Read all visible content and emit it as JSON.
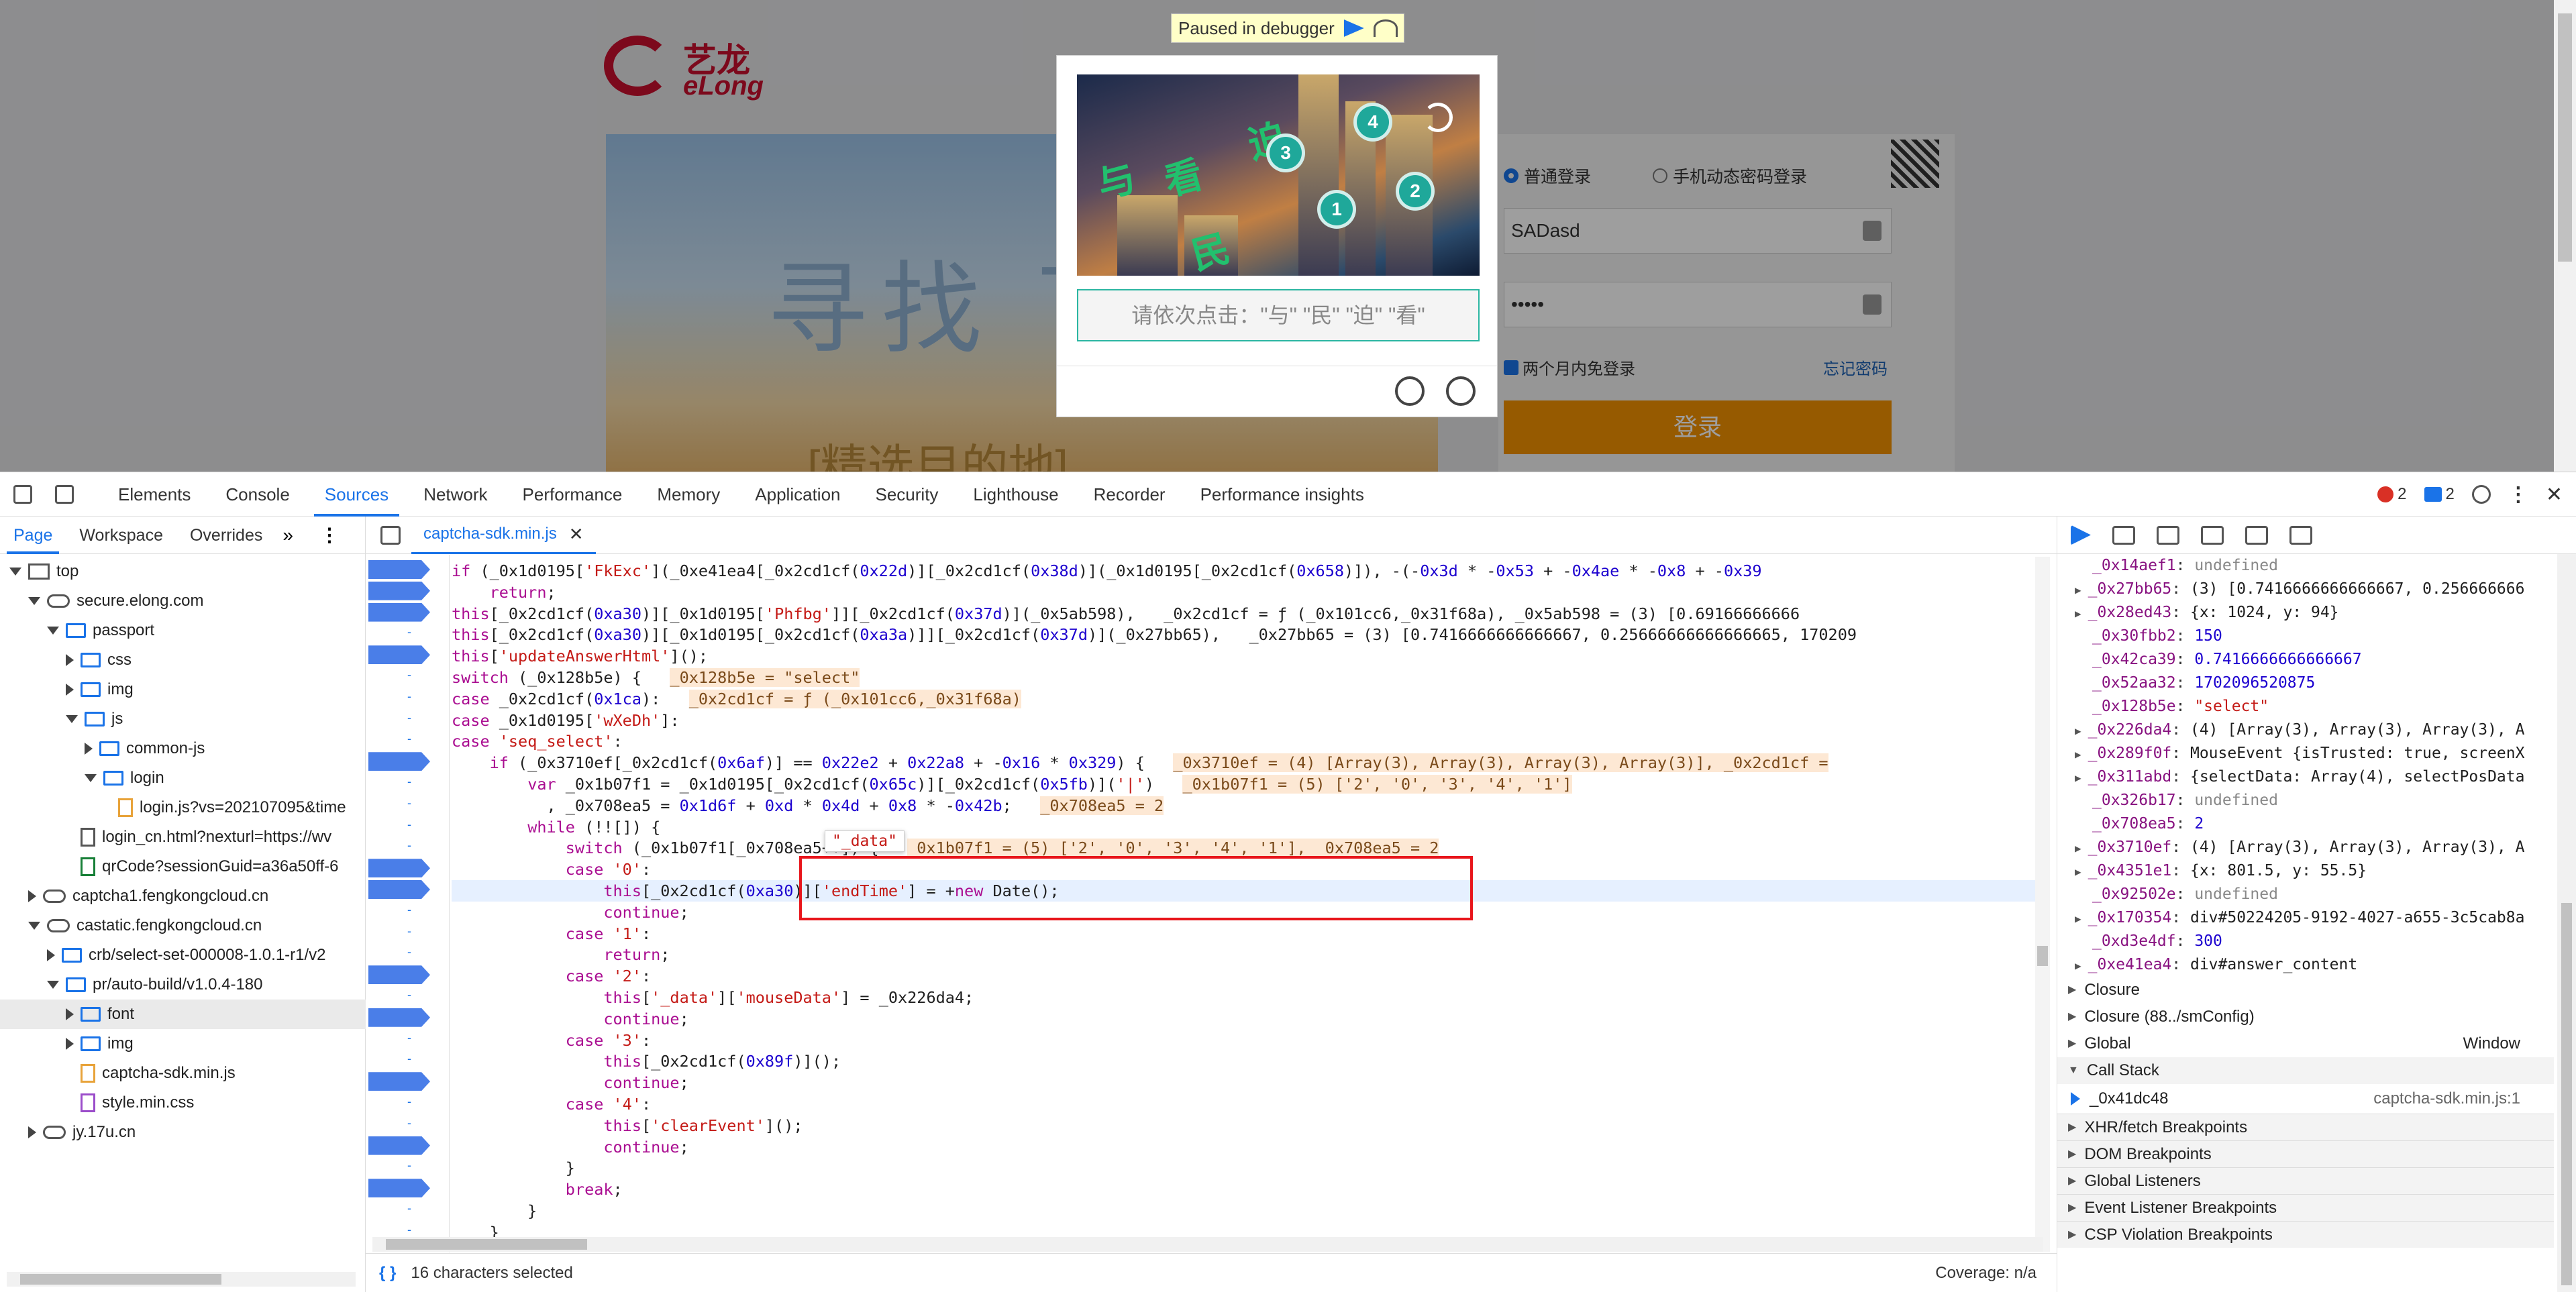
{
  "page": {
    "logo": {
      "cn": "艺龙",
      "en": "eLong"
    },
    "banner_text": "寻找 下",
    "banner_footer": "[精选目的地]",
    "paused_banner": "Paused in debugger",
    "captcha": {
      "chars": [
        "与",
        "看",
        "迫",
        "民"
      ],
      "numbers": [
        "1",
        "2",
        "3",
        "4"
      ],
      "hint": "请依次点击：\"与\" \"民\" \"迫\" \"看\""
    },
    "login": {
      "radio_normal": "普通登录",
      "radio_sms": "手机动态密码登录",
      "username_value": "SADasd",
      "password_value": "•••••",
      "remember_label": "两个月内免登录",
      "forgot_label": "忘记密码",
      "submit_label": "登录"
    }
  },
  "devtools": {
    "tabs": [
      "Elements",
      "Console",
      "Sources",
      "Network",
      "Performance",
      "Memory",
      "Application",
      "Security",
      "Lighthouse",
      "Recorder",
      "Performance insights"
    ],
    "active_tab": "Sources",
    "errors_count": "2",
    "messages_count": "2",
    "navigator_tabs": [
      "Page",
      "Workspace",
      "Overrides"
    ],
    "tree": [
      {
        "label": "top",
        "depth": 0,
        "icon": "window",
        "expand": "d"
      },
      {
        "label": "secure.elong.com",
        "depth": 1,
        "icon": "cloud",
        "expand": "d"
      },
      {
        "label": "passport",
        "depth": 2,
        "icon": "folder",
        "expand": "d"
      },
      {
        "label": "css",
        "depth": 3,
        "icon": "folder",
        "expand": "r"
      },
      {
        "label": "img",
        "depth": 3,
        "icon": "folder",
        "expand": "r"
      },
      {
        "label": "js",
        "depth": 3,
        "icon": "folder",
        "expand": "d"
      },
      {
        "label": "common-js",
        "depth": 4,
        "icon": "folder",
        "expand": "r"
      },
      {
        "label": "login",
        "depth": 4,
        "icon": "folder",
        "expand": "d"
      },
      {
        "label": "login.js?vs=202107095&time",
        "depth": 5,
        "icon": "file",
        "expand": "n"
      },
      {
        "label": "login_cn.html?nexturl=https://wv",
        "depth": 3,
        "icon": "file-html",
        "expand": "n"
      },
      {
        "label": "qrCode?sessionGuid=a36a50ff-6",
        "depth": 3,
        "icon": "file-green",
        "expand": "n"
      },
      {
        "label": "captcha1.fengkongcloud.cn",
        "depth": 1,
        "icon": "cloud",
        "expand": "r"
      },
      {
        "label": "castatic.fengkongcloud.cn",
        "depth": 1,
        "icon": "cloud",
        "expand": "d"
      },
      {
        "label": "crb/select-set-000008-1.0.1-r1/v2",
        "depth": 2,
        "icon": "folder",
        "expand": "r"
      },
      {
        "label": "pr/auto-build/v1.0.4-180",
        "depth": 2,
        "icon": "folder",
        "expand": "d"
      },
      {
        "label": "font",
        "depth": 3,
        "icon": "folder",
        "expand": "r",
        "selected": true
      },
      {
        "label": "img",
        "depth": 3,
        "icon": "folder",
        "expand": "r"
      },
      {
        "label": "captcha-sdk.min.js",
        "depth": 3,
        "icon": "file",
        "expand": "n"
      },
      {
        "label": "style.min.css",
        "depth": 3,
        "icon": "file-css",
        "expand": "n"
      },
      {
        "label": "jy.17u.cn",
        "depth": 1,
        "icon": "cloud",
        "expand": "r"
      }
    ],
    "open_file": "captcha-sdk.min.js",
    "code_lines": [
      "if (_0x1d0195['FkExc'](_0xe41ea4[_0x2cd1cf(0x22d)][_0x2cd1cf(0x38d)](_0x1d0195[_0x2cd1cf(0x658)]), -(-0x3d * -0x53 + -0x4ae * -0x8 + -0x39",
      "    return;",
      "this[_0x2cd1cf(0xa30)][_0x1d0195['Phfbg']][_0x2cd1cf(0x37d)](_0x5ab598),   _0x2cd1cf = ƒ (_0x101cc6,_0x31f68a), _0x5ab598 = (3) [0.69166666666",
      "this[_0x2cd1cf(0xa30)][_0x1d0195[_0x2cd1cf(0xa3a)]][_0x2cd1cf(0x37d)](_0x27bb65),   _0x27bb65 = (3) [0.7416666666666667, 0.25666666666666665, 170209",
      "this['updateAnswerHtml']();",
      "switch (_0x128b5e) {   _0x128b5e = \"select\"",
      "case _0x2cd1cf(0x1ca):   _0x2cd1cf = ƒ (_0x101cc6,_0x31f68a)",
      "case _0x1d0195['wXeDh']:",
      "case 'seq_select':",
      "    if (_0x3710ef[_0x2cd1cf(0x6af)] == 0x22e2 + 0x22a8 + -0x16 * 0x329) {   _0x3710ef = (4) [Array(3), Array(3), Array(3), Array(3)], _0x2cd1cf =",
      "        var _0x1b07f1 = _0x1d0195[_0x2cd1cf(0x65c)][_0x2cd1cf(0x5fb)]('|')   _0x1b07f1 = (5) ['2', '0', '3', '4', '1']",
      "          , _0x708ea5 = 0x1d6f + 0xd * 0x4d + 0x8 * -0x42b;   _0x708ea5 = 2",
      "        while (!![]) {",
      "            switch (_0x1b07f1[_0x708ea5++]) {   _0x1b07f1 = (5) ['2', '0', '3', '4', '1'], _0x708ea5 = 2",
      "            case '0':",
      "                this[_0x2cd1cf(0xa30)]['endTime'] = +new Date();",
      "                continue;",
      "            case '1':",
      "                return;",
      "            case '2':",
      "                this['_data']['mouseData'] = _0x226da4;",
      "                continue;",
      "            case '3':",
      "                this[_0x2cd1cf(0x89f)]();",
      "                continue;",
      "            case '4':",
      "                this['clearEvent']();",
      "                continue;",
      "            }",
      "            break;",
      "        }",
      "    }"
    ],
    "hover_tooltip": "\"_data\"",
    "status_selected": "16 characters selected",
    "status_coverage": "Coverage: n/a",
    "scope_vars": [
      {
        "k": "_0x14aef1",
        "v": "undefined",
        "t": "u"
      },
      {
        "k": "_0x27bb65",
        "v": "(3) [0.7416666666666667, 0.256666666",
        "t": "v",
        "exp": true
      },
      {
        "k": "_0x28ed43",
        "v": "{x: 1024, y: 94}",
        "t": "v",
        "exp": true
      },
      {
        "k": "_0x30fbb2",
        "v": "150",
        "t": "n"
      },
      {
        "k": "_0x42ca39",
        "v": "0.7416666666666667",
        "t": "n"
      },
      {
        "k": "_0x52aa32",
        "v": "1702096520875",
        "t": "n"
      },
      {
        "k": "_0x128b5e",
        "v": "\"select\"",
        "t": "s"
      },
      {
        "k": "_0x226da4",
        "v": "(4) [Array(3), Array(3), Array(3), A",
        "t": "v",
        "exp": true
      },
      {
        "k": "_0x289f0f",
        "v": "MouseEvent {isTrusted: true, screenX",
        "t": "v",
        "exp": true
      },
      {
        "k": "_0x311abd",
        "v": "{selectData: Array(4), selectPosData",
        "t": "v",
        "exp": true
      },
      {
        "k": "_0x326b17",
        "v": "undefined",
        "t": "u"
      },
      {
        "k": "_0x708ea5",
        "v": "2",
        "t": "n"
      },
      {
        "k": "_0x3710ef",
        "v": "(4) [Array(3), Array(3), Array(3), A",
        "t": "v",
        "exp": true
      },
      {
        "k": "_0x4351e1",
        "v": "{x: 801.5, y: 55.5}",
        "t": "v",
        "exp": true
      },
      {
        "k": "_0x92502e",
        "v": "undefined",
        "t": "u"
      },
      {
        "k": "_0x170354",
        "v": "div#50224205-9192-4027-a655-3c5cab8a",
        "t": "v",
        "exp": true
      },
      {
        "k": "_0xd3e4df",
        "v": "300",
        "t": "n"
      },
      {
        "k": "_0xe41ea4",
        "v": "div#answer_content",
        "t": "v",
        "exp": true
      }
    ],
    "scope_sections": [
      {
        "label": "Closure",
        "value": ""
      },
      {
        "label": "Closure (88../smConfig)",
        "value": ""
      },
      {
        "label": "Global",
        "value": "Window"
      }
    ],
    "call_stack_title": "Call Stack",
    "call_stack": [
      {
        "fn": "_0x41dc48",
        "loc": "captcha-sdk.min.js:1"
      }
    ],
    "bottom_sections": [
      "XHR/fetch Breakpoints",
      "DOM Breakpoints",
      "Global Listeners",
      "Event Listener Breakpoints",
      "CSP Violation Breakpoints"
    ]
  }
}
